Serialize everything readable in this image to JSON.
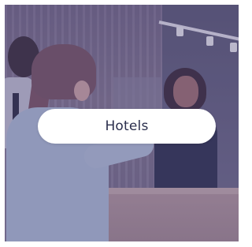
{
  "card": {
    "label": "Hotels",
    "image_subject": "hotel-reception-check-in"
  },
  "colors": {
    "overlay_tint": "#48427a",
    "pill_background": "#ffffff",
    "pill_text": "#2b2f4d"
  }
}
